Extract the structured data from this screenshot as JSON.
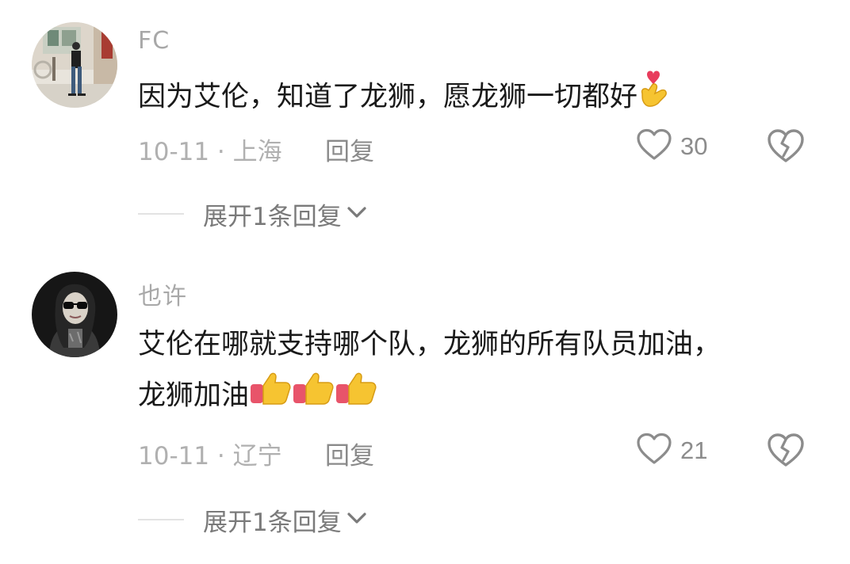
{
  "comments": [
    {
      "username": "FC",
      "text": "因为艾伦，知道了龙狮，愿龙狮一切都好",
      "text_emoji": "finger-heart-emoji",
      "date_location": "10-11 · 上海",
      "reply_label": "回复",
      "like_count": "30",
      "expand_label": "展开1条回复"
    },
    {
      "username": "也许",
      "text_line1": "艾伦在哪就支持哪个队，龙狮的所有队员加油，",
      "text_line2": "龙狮加油",
      "text_emoji": "thumbs-up-emoji",
      "text_emoji_count": 3,
      "date_location": "10-11 · 辽宁",
      "reply_label": "回复",
      "like_count": "21",
      "expand_label": "展开1条回复"
    }
  ],
  "colors": {
    "username": "#a8a8a8",
    "text": "#1a1a1a",
    "meta": "#b0b0b0",
    "icon": "#8c8c8c"
  }
}
